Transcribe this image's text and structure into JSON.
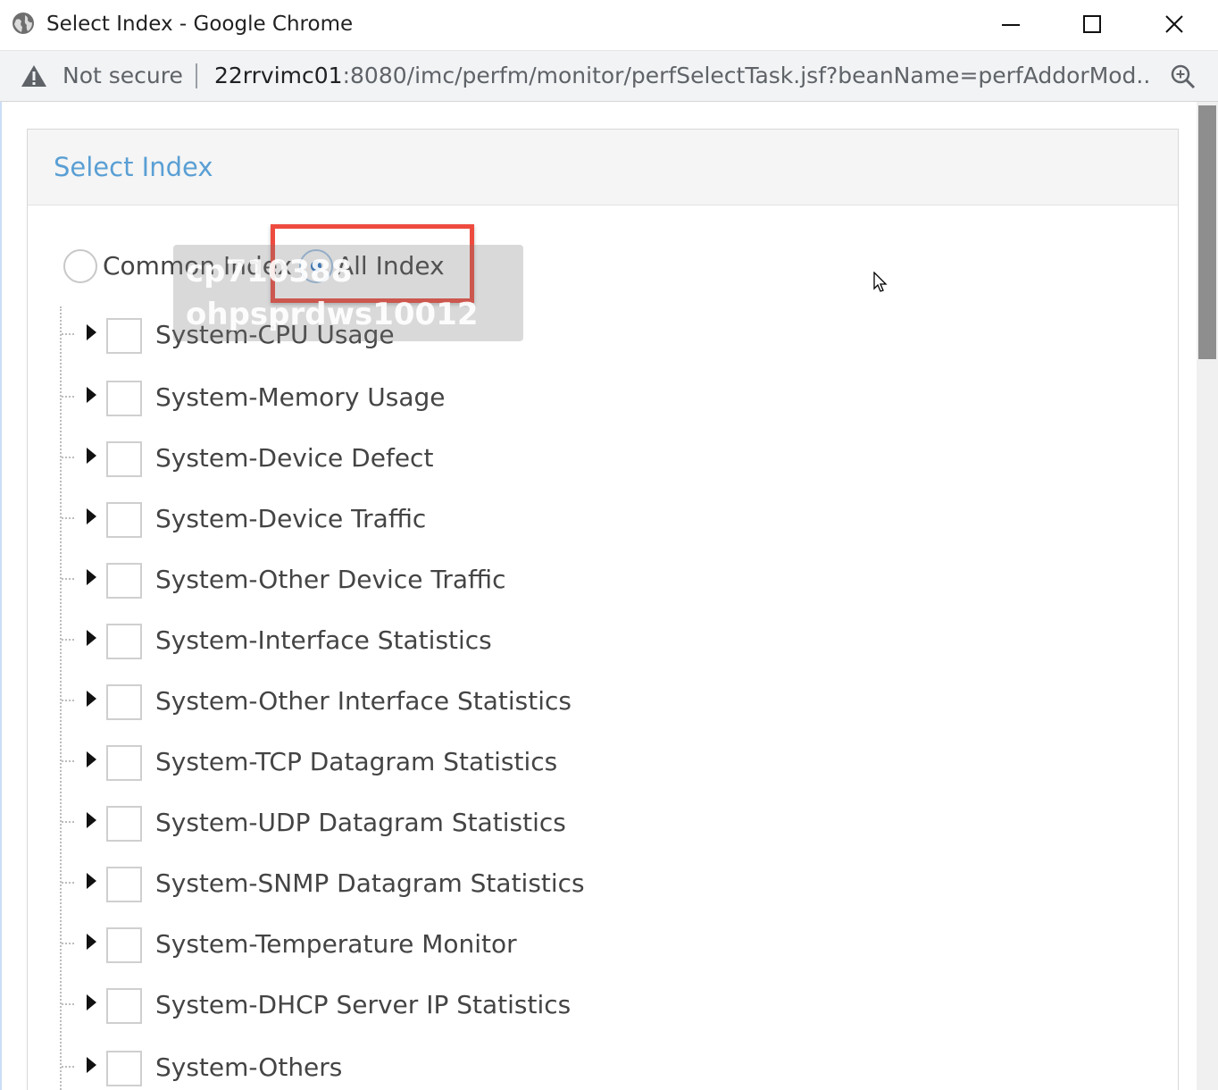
{
  "window": {
    "title": "Select Index - Google Chrome"
  },
  "address_bar": {
    "security_label": "Not secure",
    "url_host": "22rrvimc01",
    "url_rest": ":8080/imc/perfm/monitor/perfSelectTask.jsf?beanName=perfAddorMod..."
  },
  "panel": {
    "title": "Select Index"
  },
  "index_mode": {
    "options": [
      {
        "label": "Common Index",
        "selected": false
      },
      {
        "label": "All Index",
        "selected": true
      }
    ]
  },
  "tree": {
    "items": [
      {
        "label": "System-CPU Usage",
        "checked": false
      },
      {
        "label": "System-Memory Usage",
        "checked": false
      },
      {
        "label": "System-Device Defect",
        "checked": false
      },
      {
        "label": "System-Device Traffic",
        "checked": false
      },
      {
        "label": "System-Other Device Traffic",
        "checked": false
      },
      {
        "label": "System-Interface Statistics",
        "checked": false
      },
      {
        "label": "System-Other Interface Statistics",
        "checked": false
      },
      {
        "label": "System-TCP Datagram Statistics",
        "checked": false
      },
      {
        "label": "System-UDP Datagram Statistics",
        "checked": false
      },
      {
        "label": "System-SNMP Datagram Statistics",
        "checked": false
      },
      {
        "label": "System-Temperature Monitor",
        "checked": false
      },
      {
        "label": "System-DHCP Server IP Statistics",
        "checked": false
      },
      {
        "label": "System-Others",
        "checked": false
      }
    ]
  },
  "watermark": {
    "line1": "cp710388",
    "line2": "ohpsprdws10012"
  },
  "colors": {
    "panel_title": "#5a9fd4",
    "radio_selected": "#2a76c6",
    "highlight_box": "#ee4b3f"
  }
}
